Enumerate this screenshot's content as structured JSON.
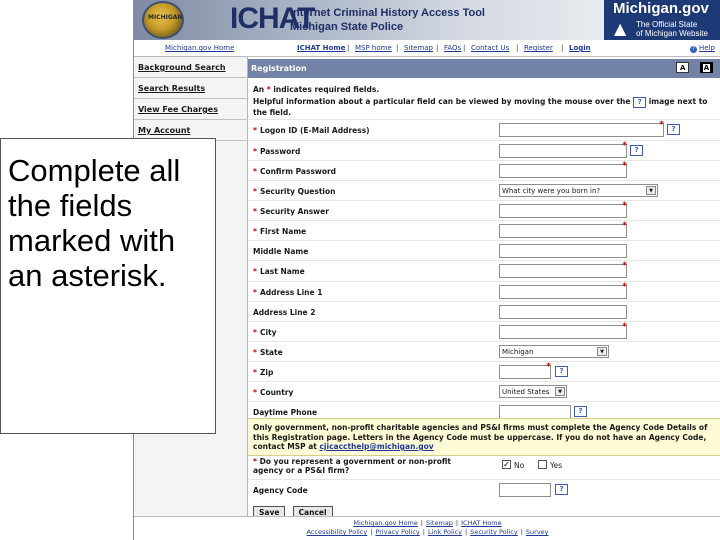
{
  "header": {
    "seal_text": "MICHIGAN",
    "app_logo": "ICHAT",
    "app_title_line1": "Internet Criminal History Access Tool",
    "app_title_line2": "Michigan State Police",
    "mi_logo": "Michigan.gov",
    "mi_tagline_line1": "The Official State",
    "mi_tagline_line2": "of Michigan Website"
  },
  "topnav": {
    "home": "Michigan.gov Home",
    "ichat_home": "ICHAT Home",
    "msp_home": "MSP home",
    "sitemap": "Sitemap",
    "faqs": "FAQs",
    "contact": "Contact Us",
    "register": "Register",
    "login": "Login",
    "help": "Help",
    "separator": "|"
  },
  "sidebar": {
    "items": [
      {
        "label": "Background Search"
      },
      {
        "label": "Search Results"
      },
      {
        "label": "View Fee Charges"
      },
      {
        "label": "My Account"
      }
    ]
  },
  "main": {
    "section_title": "Registration",
    "font_small": "A",
    "font_large": "A",
    "required_note_prefix": "An",
    "required_note_star": "*",
    "required_note_suffix": "indicates required fields.",
    "help_note_prefix": "Helpful information about a particular field can be viewed by moving the mouse over the",
    "help_note_suffix": "image next to the field.",
    "help_icon_glyph": "?",
    "fields": [
      {
        "label": "Logon ID (E-Mail Address)",
        "required": true
      },
      {
        "label": "Password",
        "required": true
      },
      {
        "label": "Confirm Password",
        "required": true
      },
      {
        "label": "Security Question",
        "required": true,
        "value": "What city were you born in?"
      },
      {
        "label": "Security Answer",
        "required": true
      },
      {
        "label": "First Name",
        "required": true
      },
      {
        "label": "Middle Name",
        "required": false
      },
      {
        "label": "Last Name",
        "required": true
      },
      {
        "label": "Address Line 1",
        "required": true
      },
      {
        "label": "Address Line 2",
        "required": false
      },
      {
        "label": "City",
        "required": true
      },
      {
        "label": "State",
        "required": true,
        "value": "Michigan"
      },
      {
        "label": "Zip",
        "required": true
      },
      {
        "label": "Country",
        "required": true,
        "value": "United States"
      },
      {
        "label": "Daytime Phone",
        "required": false
      }
    ],
    "gov_note": "Only government, non-profit charitable agencies and PS&I firms must complete the Agency Code Details of this Registration page. Letters in the Agency Code must be uppercase. If you do not have an Agency Code, contact MSP at",
    "gov_note_email": "cjicaccthelp@michigan.gov",
    "gov_question": "Do you represent a government or non-profit agency or a PS&I firm?",
    "gov_no_label": "No",
    "gov_yes_label": "Yes",
    "gov_no_checked": "✓",
    "agency_code_label": "Agency Code",
    "save_label": "Save",
    "cancel_label": "Cancel"
  },
  "footer": {
    "row1": [
      "Michigan.gov Home",
      "Sitemap",
      "ICHAT Home"
    ],
    "row2": [
      "Accessibility Policy",
      "Privacy Policy",
      "Link Policy",
      "Security Policy",
      "Survey"
    ]
  },
  "callout": {
    "text": "Complete all the fields marked with an asterisk."
  },
  "colors": {
    "header_blue": "#1e3a76",
    "section_bar": "#7383a8",
    "required_star": "#cc0000",
    "note_background": "#fffbd6",
    "link": "#1f3a9a"
  }
}
